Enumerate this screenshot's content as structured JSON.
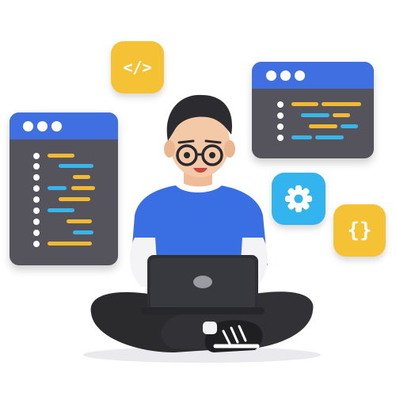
{
  "colors": {
    "window_body": "#55545d",
    "window_bar": "#3f6fe0",
    "code_yellow": "#f2b933",
    "code_blue": "#38b6ea",
    "tile_yellow": "#f6c235",
    "tile_blue": "#33b4ef",
    "shirt": "#3a6fe3",
    "pants": "#2b2b2e",
    "laptop": "#2f2f35",
    "hair": "#2c2c30",
    "skin": "#f4c9a8"
  },
  "icons": {
    "code_tag": "code-tag-icon",
    "gear": "gear-icon",
    "curly_braces": "curly-braces-icon"
  },
  "tiles": {
    "code_tag_glyph": "</>",
    "braces_glyph": "{}"
  }
}
